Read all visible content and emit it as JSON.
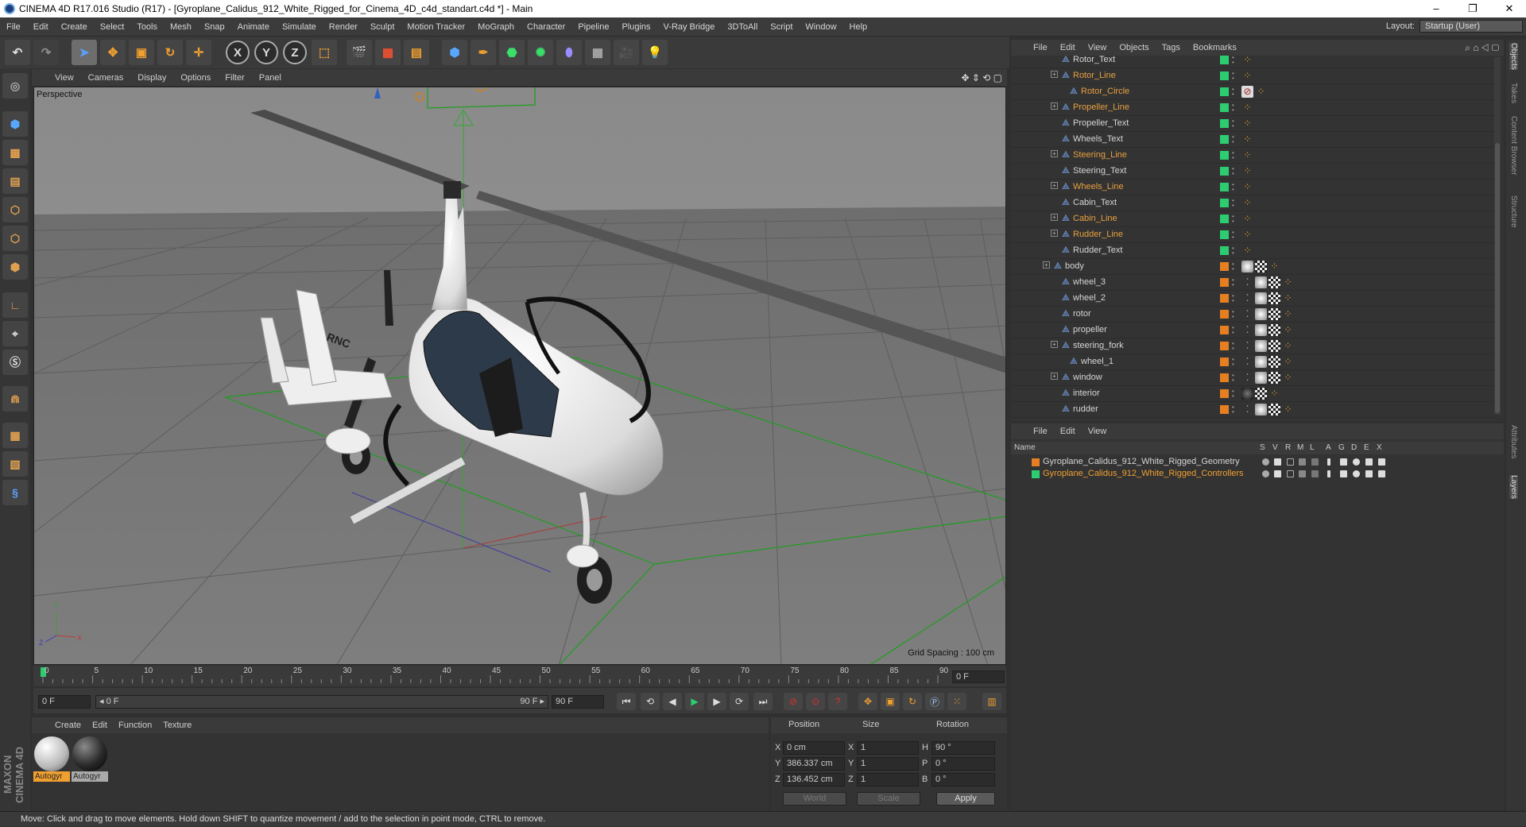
{
  "window": {
    "title": "CINEMA 4D R17.016 Studio (R17) - [Gyroplane_Calidus_912_White_Rigged_for_Cinema_4D_c4d_standart.c4d *] - Main",
    "minimize": "–",
    "maximize": "❐",
    "close": "✕"
  },
  "menubar": {
    "items": [
      "File",
      "Edit",
      "Create",
      "Select",
      "Tools",
      "Mesh",
      "Snap",
      "Animate",
      "Simulate",
      "Render",
      "Sculpt",
      "Motion Tracker",
      "MoGraph",
      "Character",
      "Pipeline",
      "Plugins",
      "V-Ray Bridge",
      "3DToAll",
      "Script",
      "Window",
      "Help"
    ],
    "layout_label": "Layout:",
    "layout_value": "Startup (User)"
  },
  "toolbar": {
    "axis_x": "X",
    "axis_y": "Y",
    "axis_z": "Z"
  },
  "viewport": {
    "menu": [
      "View",
      "Cameras",
      "Display",
      "Options",
      "Filter",
      "Panel"
    ],
    "label": "Perspective",
    "grid_spacing": "Grid Spacing : 100 cm",
    "model_text": "RNC",
    "axis_y": "Y",
    "axis_x": "X",
    "axis_z": "Z"
  },
  "timeline": {
    "ticks": [
      "0",
      "5",
      "10",
      "15",
      "20",
      "25",
      "30",
      "35",
      "40",
      "45",
      "50",
      "55",
      "60",
      "65",
      "70",
      "75",
      "80",
      "85",
      "90"
    ],
    "current_frame": "0 F",
    "start_field": "0 F",
    "range_start": "◂ 0 F",
    "range_end": "90 F ▸",
    "end_field": "90 F"
  },
  "materials": {
    "menu": [
      "Create",
      "Edit",
      "Function",
      "Texture"
    ],
    "items": [
      {
        "label": "Autogyr",
        "selected": true
      },
      {
        "label": "Autogyr",
        "selected": false
      }
    ]
  },
  "coordinates": {
    "headers": {
      "position": "Position",
      "size": "Size",
      "rotation": "Rotation"
    },
    "rows": [
      {
        "axis": "X",
        "pos": "0 cm",
        "size_axis": "X",
        "size": "1",
        "rot_axis": "H",
        "rot": "90 °"
      },
      {
        "axis": "Y",
        "pos": "386.337 cm",
        "size_axis": "Y",
        "size": "1",
        "rot_axis": "P",
        "rot": "0 °"
      },
      {
        "axis": "Z",
        "pos": "136.452 cm",
        "size_axis": "Z",
        "size": "1",
        "rot_axis": "B",
        "rot": "0 °"
      }
    ],
    "mode1": "World",
    "mode2": "Scale",
    "apply": "Apply"
  },
  "status": "Move: Click and drag to move elements. Hold down SHIFT to quantize movement / add to the selection in point mode, CTRL to remove.",
  "object_manager": {
    "menu": [
      "File",
      "Edit",
      "View",
      "Objects",
      "Tags",
      "Bookmarks"
    ],
    "rows": [
      {
        "name": "Rotor_Text",
        "indent": 1,
        "expand": false,
        "highlight": false,
        "layer": "#2ecc71",
        "tags": 1
      },
      {
        "name": "Rotor_Line",
        "indent": 1,
        "expand": true,
        "highlight": true,
        "layer": "#2ecc71",
        "tags": 1
      },
      {
        "name": "Rotor_Circle",
        "indent": 2,
        "expand": false,
        "highlight": true,
        "layer": "#2ecc71",
        "tags": 2
      },
      {
        "name": "Propeller_Line",
        "indent": 1,
        "expand": true,
        "highlight": true,
        "layer": "#2ecc71",
        "tags": 1
      },
      {
        "name": "Propeller_Text",
        "indent": 1,
        "expand": false,
        "highlight": false,
        "layer": "#2ecc71",
        "tags": 1
      },
      {
        "name": "Wheels_Text",
        "indent": 1,
        "expand": false,
        "highlight": false,
        "layer": "#2ecc71",
        "tags": 1
      },
      {
        "name": "Steering_Line",
        "indent": 1,
        "expand": true,
        "highlight": true,
        "layer": "#2ecc71",
        "tags": 1
      },
      {
        "name": "Steering_Text",
        "indent": 1,
        "expand": false,
        "highlight": false,
        "layer": "#2ecc71",
        "tags": 1
      },
      {
        "name": "Wheels_Line",
        "indent": 1,
        "expand": true,
        "highlight": true,
        "layer": "#2ecc71",
        "tags": 1
      },
      {
        "name": "Cabin_Text",
        "indent": 1,
        "expand": false,
        "highlight": false,
        "layer": "#2ecc71",
        "tags": 1
      },
      {
        "name": "Cabin_Line",
        "indent": 1,
        "expand": true,
        "highlight": true,
        "layer": "#2ecc71",
        "tags": 1
      },
      {
        "name": "Rudder_Line",
        "indent": 1,
        "expand": true,
        "highlight": true,
        "layer": "#2ecc71",
        "tags": 1
      },
      {
        "name": "Rudder_Text",
        "indent": 1,
        "expand": false,
        "highlight": false,
        "layer": "#2ecc71",
        "tags": 1
      },
      {
        "name": "body",
        "indent": 0,
        "expand": true,
        "highlight": false,
        "layer": "#e67e22",
        "tags": 3
      },
      {
        "name": "wheel_3",
        "indent": 1,
        "expand": false,
        "highlight": false,
        "layer": "#e67e22",
        "tags": 4
      },
      {
        "name": "wheel_2",
        "indent": 1,
        "expand": false,
        "highlight": false,
        "layer": "#e67e22",
        "tags": 4
      },
      {
        "name": "rotor",
        "indent": 1,
        "expand": false,
        "highlight": false,
        "layer": "#e67e22",
        "tags": 4
      },
      {
        "name": "propeller",
        "indent": 1,
        "expand": false,
        "highlight": false,
        "layer": "#e67e22",
        "tags": 4
      },
      {
        "name": "steering_fork",
        "indent": 1,
        "expand": true,
        "highlight": false,
        "layer": "#e67e22",
        "tags": 4
      },
      {
        "name": "wheel_1",
        "indent": 2,
        "expand": false,
        "highlight": false,
        "layer": "#e67e22",
        "tags": 4
      },
      {
        "name": "window",
        "indent": 1,
        "expand": true,
        "highlight": false,
        "layer": "#e67e22",
        "tags": 4
      },
      {
        "name": "interior",
        "indent": 1,
        "expand": false,
        "highlight": false,
        "layer": "#e67e22",
        "tags": 3
      },
      {
        "name": "rudder",
        "indent": 1,
        "expand": false,
        "highlight": false,
        "layer": "#e67e22",
        "tags": 4
      }
    ]
  },
  "layer_manager": {
    "menu": [
      "File",
      "Edit",
      "View"
    ],
    "columns": [
      "Name",
      "S",
      "V",
      "R",
      "M",
      "L",
      "A",
      "G",
      "D",
      "E",
      "X"
    ],
    "layers": [
      {
        "name": "Gyroplane_Calidus_912_White_Rigged_Geometry",
        "color": "#e67e22",
        "text_color": "#d6d6d6"
      },
      {
        "name": "Gyroplane_Calidus_912_White_Rigged_Controllers",
        "color": "#2ecc71",
        "text_color": "#f0a030"
      }
    ]
  },
  "right_tabs": [
    "Objects",
    "Takes",
    "Content Browser",
    "Structure",
    "Attributes",
    "Layers"
  ]
}
